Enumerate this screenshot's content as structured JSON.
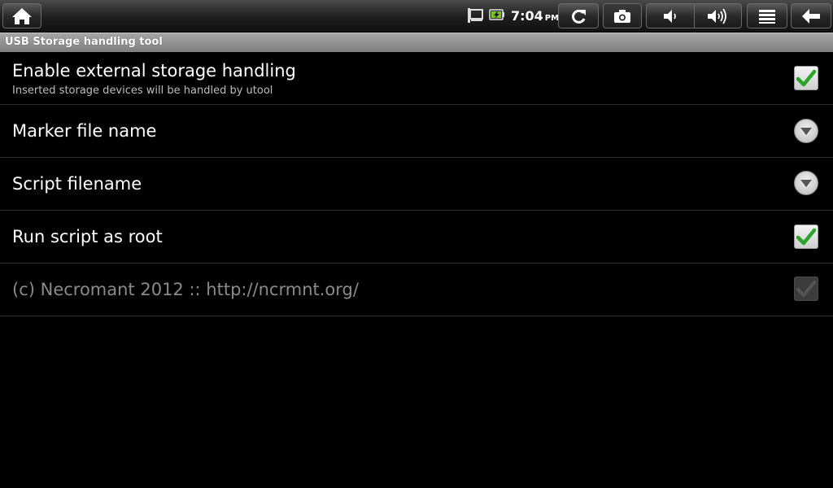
{
  "status_bar": {
    "time": "7:04",
    "ampm": "PM",
    "icons": [
      "home-icon",
      "usb-debug-icon",
      "battery-charging-icon",
      "sync-icon",
      "camera-icon",
      "volume-down-icon",
      "volume-up-icon",
      "menu-icon",
      "back-arrow-icon"
    ]
  },
  "app": {
    "title": "USB Storage handling tool"
  },
  "preferences": [
    {
      "title": "Enable external storage handling",
      "summary": "Inserted storage devices will be handled by utool",
      "control": "checkbox",
      "checked": true,
      "enabled": true
    },
    {
      "title": "Marker file name",
      "control": "dropdown",
      "enabled": true
    },
    {
      "title": "Script filename",
      "control": "dropdown",
      "enabled": true
    },
    {
      "title": "Run script as root",
      "control": "checkbox",
      "checked": true,
      "enabled": true
    },
    {
      "title": "(c) Necromant 2012 :: http://ncrmnt.org/",
      "control": "checkbox",
      "checked": true,
      "enabled": false
    }
  ],
  "colors": {
    "check_green": "#2aa52a",
    "title_bar": "#8e8e8e",
    "disabled_text": "#8a8a8a"
  }
}
